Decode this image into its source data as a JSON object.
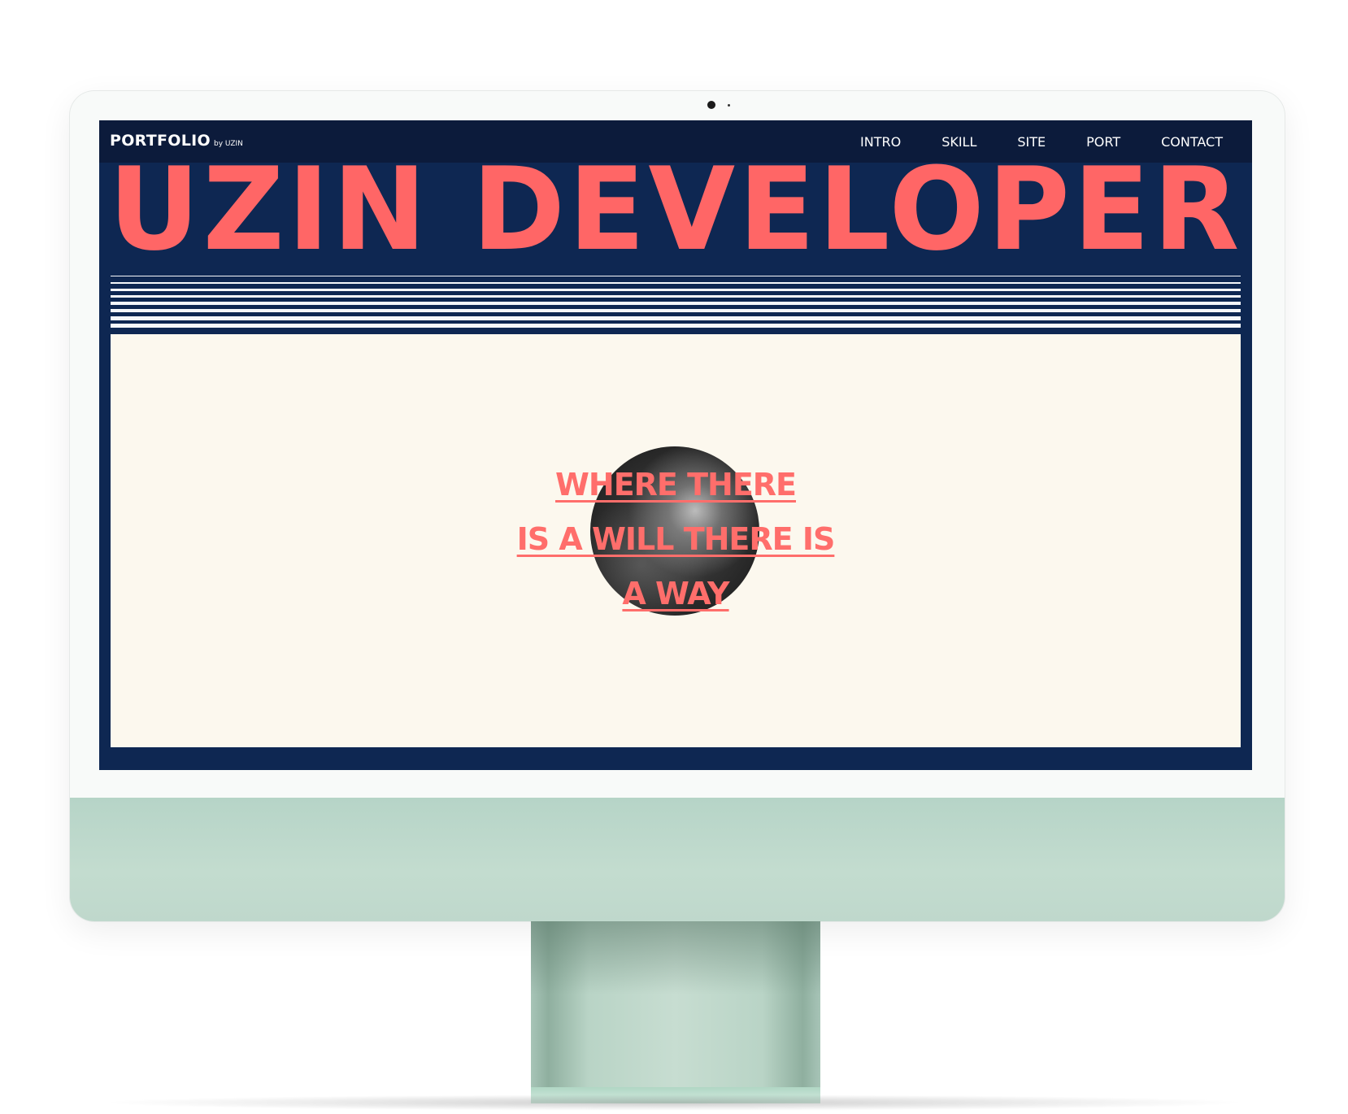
{
  "nav": {
    "logo": "PORTFOLIO",
    "logo_by": "by UZIN",
    "items": [
      {
        "label": "INTRO"
      },
      {
        "label": "SKILL"
      },
      {
        "label": "SITE"
      },
      {
        "label": "PORT"
      },
      {
        "label": "CONTACT"
      }
    ]
  },
  "hero": {
    "title": "UZIN DEVELOPER",
    "quote_lines": [
      "WHERE THERE",
      "IS A WILL THERE IS",
      "A WAY"
    ]
  },
  "colors": {
    "navy": "#0e2752",
    "nav_bar": "#0c1b3b",
    "accent": "#ff6666",
    "cream": "#fcf8ee",
    "device_green": "#b6d4c7"
  }
}
